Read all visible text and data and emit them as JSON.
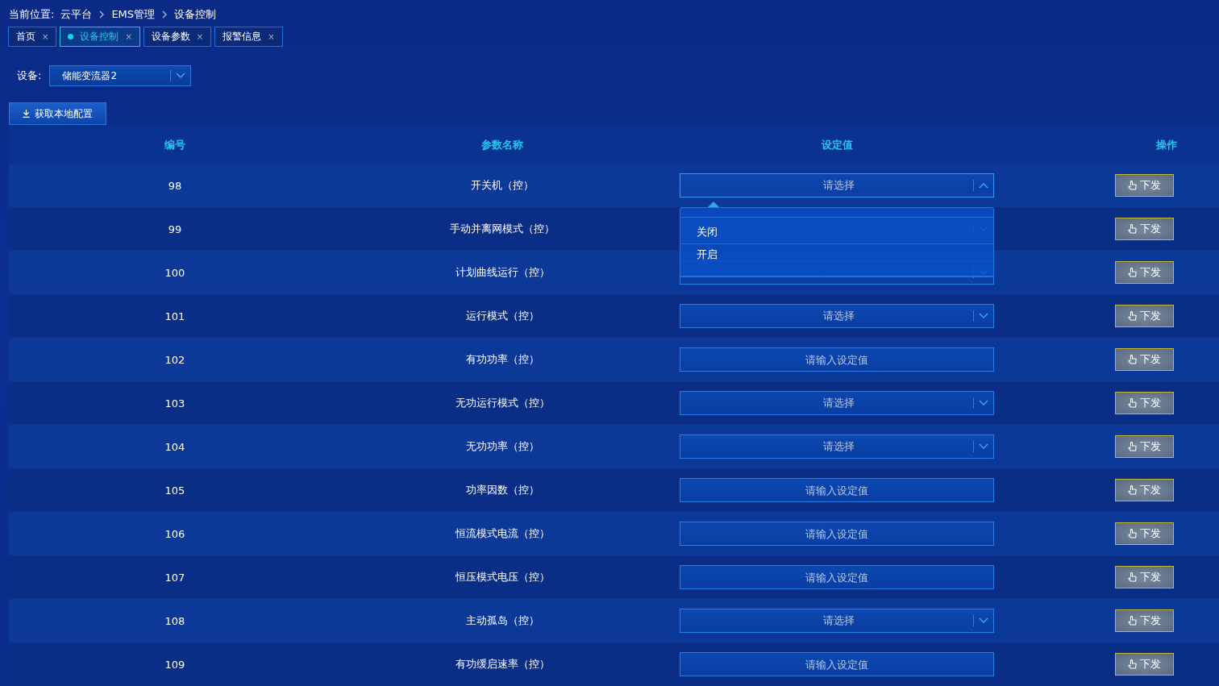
{
  "breadcrumb": {
    "label": "当前位置:",
    "items": [
      "云平台",
      "EMS管理",
      "设备控制"
    ]
  },
  "tabs": [
    {
      "label": "首页",
      "close": "×",
      "selected": false
    },
    {
      "label": "设备控制",
      "close": "×",
      "selected": true
    },
    {
      "label": "设备参数",
      "close": "×",
      "selected": false
    },
    {
      "label": "报警信息",
      "close": "×",
      "selected": false
    }
  ],
  "device": {
    "label": "设备:",
    "value": "储能变流器2"
  },
  "fetch_button": "获取本地配置",
  "table": {
    "columns": [
      "编号",
      "参数名称",
      "设定值",
      "操作"
    ],
    "rows": [
      {
        "id": "98",
        "name": "开关机（控）",
        "kind": "select",
        "value": "请选择",
        "expanded": true,
        "options": [
          "关闭",
          "开启"
        ],
        "action": "下发"
      },
      {
        "id": "99",
        "name": "手动并离网模式（控）",
        "kind": "select",
        "expanded": false,
        "action": "下发"
      },
      {
        "id": "100",
        "name": "计划曲线运行（控）",
        "kind": "select",
        "expanded": false,
        "action": "下发"
      },
      {
        "id": "101",
        "name": "运行模式（控）",
        "kind": "select",
        "value": "请选择",
        "expanded": false,
        "action": "下发"
      },
      {
        "id": "102",
        "name": "有功功率（控）",
        "kind": "input",
        "placeholder": "请输入设定值",
        "action": "下发"
      },
      {
        "id": "103",
        "name": "无功运行模式（控）",
        "kind": "select",
        "value": "请选择",
        "expanded": false,
        "action": "下发"
      },
      {
        "id": "104",
        "name": "无功功率（控）",
        "kind": "select",
        "value": "请选择",
        "expanded": false,
        "action": "下发"
      },
      {
        "id": "105",
        "name": "功率因数（控）",
        "kind": "input",
        "placeholder": "请输入设定值",
        "action": "下发"
      },
      {
        "id": "106",
        "name": "恒流模式电流（控）",
        "kind": "input",
        "placeholder": "请输入设定值",
        "action": "下发"
      },
      {
        "id": "107",
        "name": "恒压模式电压（控）",
        "kind": "input",
        "placeholder": "请输入设定值",
        "action": "下发"
      },
      {
        "id": "108",
        "name": "主动孤岛（控）",
        "kind": "select",
        "value": "请选择",
        "expanded": false,
        "action": "下发"
      },
      {
        "id": "109",
        "name": "有功缓启速率（控）",
        "kind": "input",
        "placeholder": "请输入设定值",
        "action": "下发"
      }
    ]
  }
}
